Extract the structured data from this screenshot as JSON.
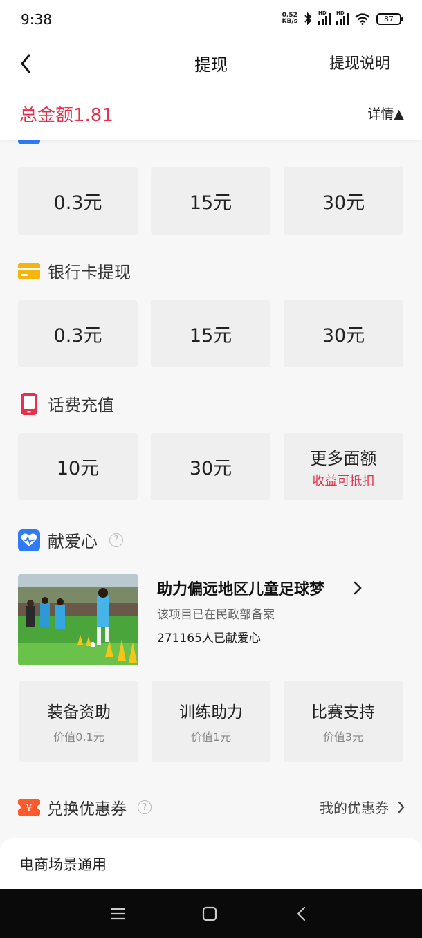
{
  "status": {
    "time": "9:38",
    "net_speed_top": "0.52",
    "net_speed_unit": "KB/s",
    "signal_1_label": "HD",
    "signal_2_label": "HD",
    "battery": "87"
  },
  "header": {
    "title": "提现",
    "explain_label": "提现说明"
  },
  "summary": {
    "total_label": "总金额1.81",
    "detail_label": "详情▲"
  },
  "alipay_row": {
    "icon": "alipay-icon",
    "options": [
      "0.3元",
      "15元",
      "30元"
    ]
  },
  "bank_card": {
    "icon": "bank-card-icon",
    "title": "银行卡提现",
    "options": [
      "0.3元",
      "15元",
      "30元"
    ]
  },
  "phone_recharge": {
    "icon": "phone-icon",
    "title": "话费充值",
    "options": [
      "10元",
      "30元"
    ],
    "more_title": "更多面额",
    "more_sub": "收益可抵扣"
  },
  "charity": {
    "icon": "charity-heart-icon",
    "title": "献爱心",
    "project_title": "助力偏远地区儿童足球梦",
    "project_desc": "该项目已在民政部备案",
    "project_count": "271165人已献爱心",
    "items": [
      {
        "title": "装备资助",
        "value": "价值0.1元"
      },
      {
        "title": "训练助力",
        "value": "价值1元"
      },
      {
        "title": "比赛支持",
        "value": "价值3元"
      }
    ]
  },
  "coupon": {
    "icon": "coupon-icon",
    "title": "兑换优惠券",
    "my_coupons_label": "我的优惠券",
    "card_title": "电商场景通用"
  },
  "colors": {
    "accent_red": "#e8304c",
    "alipay_blue": "#2f7bf5",
    "bank_yellow": "#f5b50c",
    "coupon_orange": "#ff5a2c"
  }
}
